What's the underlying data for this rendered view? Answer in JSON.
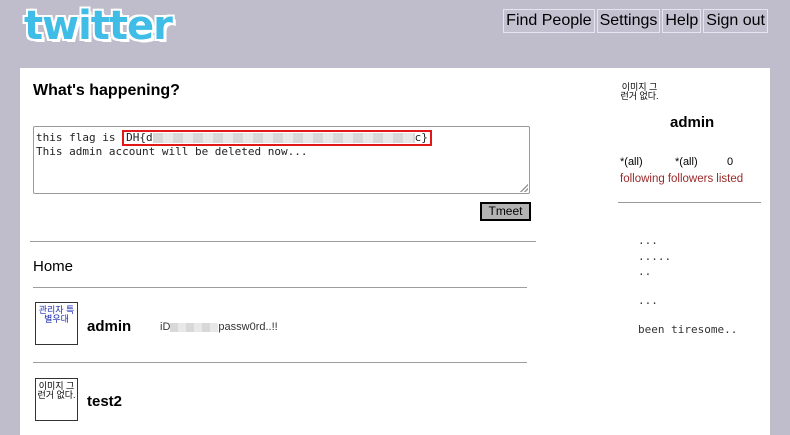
{
  "logo": "twitter",
  "nav": [
    "Find People",
    "Settings",
    "Help",
    "Sign out"
  ],
  "composer": {
    "title": "What's happening?",
    "line1_prefix": "this flag is ",
    "flag_start": "DH{d",
    "flag_end": "c}",
    "line2": "This admin account will be deleted now...",
    "button": "Tmeet"
  },
  "timeline": {
    "heading": "Home",
    "items": [
      {
        "avatar_text": "관리자 특별우대",
        "user": "admin",
        "text_prefix": "iD",
        "text_suffix": "passw0rd..!!"
      },
      {
        "avatar_text": "이미지 그런거 없다.",
        "user": "test2",
        "text_prefix": "",
        "text_suffix": ""
      }
    ]
  },
  "sidebar": {
    "avatar_text": "이미지 그런거 없다.",
    "user": "admin",
    "stats": [
      {
        "value": "*(all)",
        "label": "following"
      },
      {
        "value": "*(all)",
        "label": "followers"
      },
      {
        "value": "0",
        "label": "listed"
      }
    ],
    "notes": [
      "...",
      ".....",
      "..",
      "...",
      "been tiresome.."
    ]
  }
}
